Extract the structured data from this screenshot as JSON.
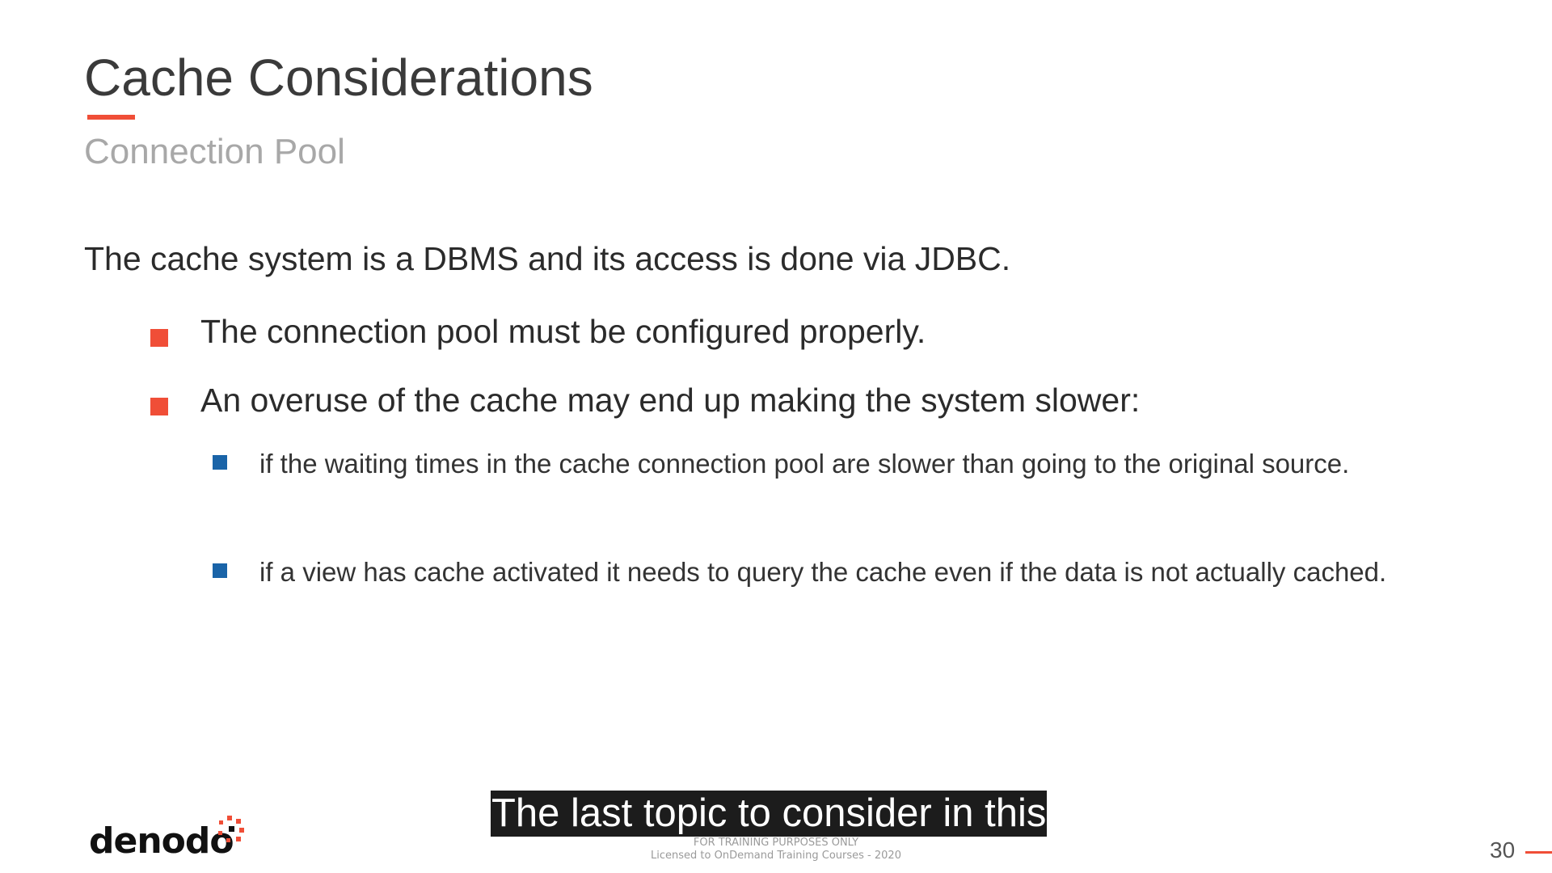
{
  "slide": {
    "title": "Cache Considerations",
    "subtitle": "Connection Pool",
    "lead": "The cache system is a DBMS and its access is done via JDBC.",
    "bullets": [
      {
        "text": "The connection pool must be configured properly.",
        "color": "#f04e37"
      },
      {
        "text": "An overuse of the cache may end up making the system slower:",
        "color": "#f04e37",
        "sub_bullets": [
          {
            "text": "if the waiting times in the cache connection pool are slower than going to the original source.",
            "color": "#1a64a8"
          },
          {
            "text": "if a view has cache activated it needs to query the cache even if the data is not actually cached.",
            "color": "#1a64a8"
          }
        ]
      }
    ]
  },
  "caption": {
    "text": "The last topic to consider in this"
  },
  "footer": {
    "notice_line1": "FOR TRAINING PURPOSES ONLY",
    "notice_line2": "Licensed to OnDemand Training Courses - 2020",
    "logo_text": "denodo",
    "logo_icon": "denodo-dots-logo-icon",
    "page_number": "30"
  },
  "colors": {
    "accent": "#f04e37",
    "sub_bullet": "#1a64a8",
    "subtitle": "#a8a8a8"
  }
}
